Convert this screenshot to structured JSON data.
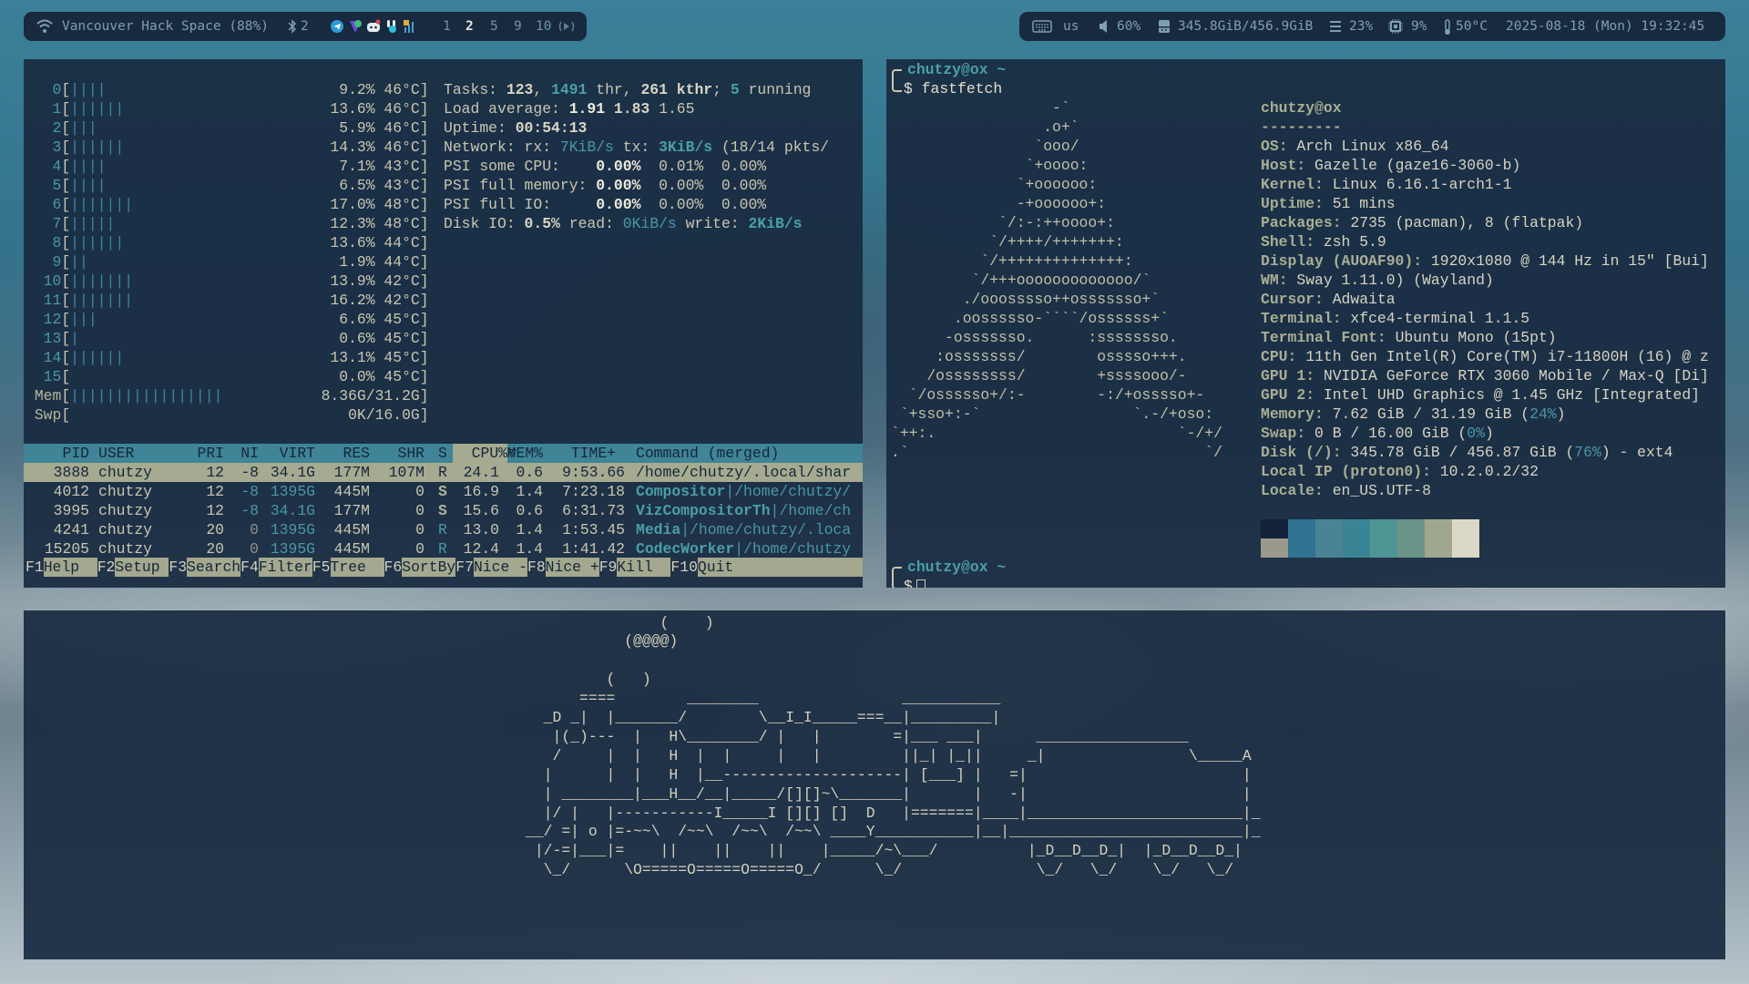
{
  "topbar_left": {
    "wifi_icon": "wifi-icon",
    "network": "Vancouver Hack Space (88%)",
    "bluetooth_icon": "bluetooth-icon",
    "bluetooth_count": "2",
    "tray_icons": [
      "telegram-icon",
      "protonvpn-icon",
      "discord-icon",
      "slack-icon",
      "network-manager-icon"
    ],
    "workspaces": [
      {
        "label": "1",
        "active": false
      },
      {
        "label": "2",
        "active": true
      },
      {
        "label": "5",
        "active": false
      },
      {
        "label": "9",
        "active": false
      },
      {
        "label": "10",
        "active": false
      }
    ],
    "audio_icon": "audio-output-icon"
  },
  "topbar_right": {
    "keyboard_layout": "us",
    "volume": "60%",
    "disk": "345.8GiB/456.9GiB",
    "memory": "23%",
    "cpu": "9%",
    "temperature": "50°C",
    "datetime": "2025-08-18 (Mon) 19:32:45"
  },
  "htop": {
    "cpus": [
      {
        "label": "0",
        "bars": 4,
        "pct": "9.2%",
        "temp": "46°C"
      },
      {
        "label": "1",
        "bars": 6,
        "pct": "13.6%",
        "temp": "46°C"
      },
      {
        "label": "2",
        "bars": 3,
        "pct": "5.9%",
        "temp": "46°C"
      },
      {
        "label": "3",
        "bars": 6,
        "pct": "14.3%",
        "temp": "46°C"
      },
      {
        "label": "4",
        "bars": 4,
        "pct": "7.1%",
        "temp": "43°C"
      },
      {
        "label": "5",
        "bars": 4,
        "pct": "6.5%",
        "temp": "43°C"
      },
      {
        "label": "6",
        "bars": 7,
        "pct": "17.0%",
        "temp": "48°C"
      },
      {
        "label": "7",
        "bars": 5,
        "pct": "12.3%",
        "temp": "48°C"
      },
      {
        "label": "8",
        "bars": 6,
        "pct": "13.6%",
        "temp": "44°C"
      },
      {
        "label": "9",
        "bars": 2,
        "pct": "1.9%",
        "temp": "44°C"
      },
      {
        "label": "10",
        "bars": 7,
        "pct": "13.9%",
        "temp": "42°C"
      },
      {
        "label": "11",
        "bars": 7,
        "pct": "16.2%",
        "temp": "42°C"
      },
      {
        "label": "12",
        "bars": 3,
        "pct": "6.6%",
        "temp": "45°C"
      },
      {
        "label": "13",
        "bars": 1,
        "pct": "0.6%",
        "temp": "45°C"
      },
      {
        "label": "14",
        "bars": 6,
        "pct": "13.1%",
        "temp": "45°C"
      },
      {
        "label": "15",
        "bars": 0,
        "pct": "0.0%",
        "temp": "45°C"
      }
    ],
    "mem": {
      "label": "Mem",
      "bars": 17,
      "value": "8.36G/31.2G"
    },
    "swp": {
      "label": "Swp",
      "bars": 0,
      "value": "0K/16.0G"
    },
    "info": [
      [
        {
          "t": "Tasks: ",
          "c": ""
        },
        {
          "t": "123",
          "c": "bold"
        },
        {
          "t": ", ",
          "c": ""
        },
        {
          "t": "1491",
          "c": "cyb"
        },
        {
          "t": " thr, ",
          "c": ""
        },
        {
          "t": "261 kthr",
          "c": "bold"
        },
        {
          "t": "; ",
          "c": ""
        },
        {
          "t": "5",
          "c": "cyb"
        },
        {
          "t": " running",
          "c": ""
        }
      ],
      [
        {
          "t": "Load average: ",
          "c": ""
        },
        {
          "t": "1.91",
          "c": "wb"
        },
        {
          "t": " ",
          "c": ""
        },
        {
          "t": "1.83",
          "c": "bold"
        },
        {
          "t": " 1.65",
          "c": ""
        }
      ],
      [
        {
          "t": "Uptime: ",
          "c": ""
        },
        {
          "t": "00:54:13",
          "c": "bold"
        }
      ],
      [
        {
          "t": "Network: rx: ",
          "c": ""
        },
        {
          "t": "7KiB/s",
          "c": "cy"
        },
        {
          "t": " tx: ",
          "c": ""
        },
        {
          "t": "3KiB/s",
          "c": "cyb"
        },
        {
          "t": " (18/14 pkts/",
          "c": ""
        }
      ],
      [
        {
          "t": "PSI some CPU:    ",
          "c": ""
        },
        {
          "t": "0.00%",
          "c": "wb"
        },
        {
          "t": "  0.01%  0.00%",
          "c": ""
        }
      ],
      [
        {
          "t": "PSI full memory: ",
          "c": ""
        },
        {
          "t": "0.00%",
          "c": "wb"
        },
        {
          "t": "  0.00%  0.00%",
          "c": ""
        }
      ],
      [
        {
          "t": "PSI full IO:     ",
          "c": ""
        },
        {
          "t": "0.00%",
          "c": "wb"
        },
        {
          "t": "  0.00%  0.00%",
          "c": ""
        }
      ],
      [
        {
          "t": "Disk IO: ",
          "c": ""
        },
        {
          "t": "0.5%",
          "c": "bold"
        },
        {
          "t": " read: ",
          "c": ""
        },
        {
          "t": "0KiB/s",
          "c": "cy"
        },
        {
          "t": " write: ",
          "c": ""
        },
        {
          "t": "2KiB/s",
          "c": "cyb"
        }
      ]
    ],
    "columns": {
      "pid": "PID",
      "user": "USER",
      "pri": "PRI",
      "ni": "NI",
      "virt": "VIRT",
      "res": "RES",
      "shr": "SHR",
      "s": "S",
      "cpu": "CPU%",
      "sort": "▽",
      "mem": "MEM%",
      "time": "TIME+",
      "cmd": "Command (merged)"
    },
    "processes": [
      {
        "pid": "3888",
        "user": "chutzy",
        "pri": "12",
        "ni": "-8",
        "virt": "34.1G",
        "res": "177M",
        "shr": "107M",
        "s": "R",
        "cpu": "24.1",
        "mem": "0.6",
        "time": "9:53.66",
        "name": "",
        "sep": "",
        "path": "/home/chutzy/.local/shar",
        "selected": true
      },
      {
        "pid": "4012",
        "user": "chutzy",
        "pri": "12",
        "ni": "-8",
        "virt": "1395G",
        "res": "445M",
        "shr": "0",
        "s": "S",
        "cpu": "16.9",
        "mem": "1.4",
        "time": "7:23.18",
        "name": "Compositor",
        "sep": "|",
        "path": "/home/chutzy/",
        "selected": false
      },
      {
        "pid": "3995",
        "user": "chutzy",
        "pri": "12",
        "ni": "-8",
        "virt": "34.1G",
        "res": "177M",
        "shr": "0",
        "s": "S",
        "cpu": "15.6",
        "mem": "0.6",
        "time": "6:31.73",
        "name": "VizCompositorTh",
        "sep": "|",
        "path": "/home/ch",
        "selected": false
      },
      {
        "pid": "4241",
        "user": "chutzy",
        "pri": "20",
        "ni": "0",
        "virt": "1395G",
        "res": "445M",
        "shr": "0",
        "s": "R",
        "cpu": "13.0",
        "mem": "1.4",
        "time": "1:53.45",
        "name": "Media",
        "sep": "|",
        "path": "/home/chutzy/.loca",
        "selected": false
      },
      {
        "pid": "15205",
        "user": "chutzy",
        "pri": "20",
        "ni": "0",
        "virt": "1395G",
        "res": "445M",
        "shr": "0",
        "s": "R",
        "cpu": "12.4",
        "mem": "1.4",
        "time": "1:41.42",
        "name": "CodecWorker",
        "sep": "|",
        "path": "/home/chutzy",
        "selected": false
      }
    ],
    "footer": [
      {
        "key": "F1",
        "label": "Help"
      },
      {
        "key": "F2",
        "label": "Setup"
      },
      {
        "key": "F3",
        "label": "Search"
      },
      {
        "key": "F4",
        "label": "Filter"
      },
      {
        "key": "F5",
        "label": "Tree"
      },
      {
        "key": "F6",
        "label": "SortBy"
      },
      {
        "key": "F7",
        "label": "Nice -"
      },
      {
        "key": "F8",
        "label": "Nice +"
      },
      {
        "key": "F9",
        "label": "Kill"
      },
      {
        "key": "F10",
        "label": "Quit"
      }
    ]
  },
  "fastfetch": {
    "prompt": "chutzy@ox ~",
    "command": "$ fastfetch",
    "logo": [
      "                  -`",
      "                 .o+`",
      "                `ooo/",
      "               `+oooo:",
      "              `+oooooo:",
      "              -+oooooo+:",
      "            `/:-:++oooo+:",
      "           `/++++/+++++++:",
      "          `/++++++++++++++:",
      "         `/+++ooooooooooooo/`",
      "        ./ooosssso++osssssso+`",
      "       .oossssso-````/ossssss+`",
      "      -osssssso.      :ssssssso.",
      "     :osssssss/        osssso+++.",
      "    /ossssssss/        +ssssooo/-",
      "  `/ossssso+/:-        -:/+osssso+-",
      " `+sso+:-`                 `.-/+oso:",
      "`++:.                           `-/+/",
      ".`                                 `/"
    ],
    "title": "chutzy@ox",
    "separator": "---------",
    "info": [
      {
        "key": "OS",
        "value": "Arch Linux x86_64"
      },
      {
        "key": "Host",
        "value": "Gazelle (gaze16-3060-b)"
      },
      {
        "key": "Kernel",
        "value": "Linux 6.16.1-arch1-1"
      },
      {
        "key": "Uptime",
        "value": "51 mins"
      },
      {
        "key": "Packages",
        "value": "2735 (pacman), 8 (flatpak)"
      },
      {
        "key": "Shell",
        "value": "zsh 5.9"
      },
      {
        "key": "Display (AUOAF90)",
        "value": "1920x1080 @ 144 Hz in 15\" [Bui]"
      },
      {
        "key": "WM",
        "value": "Sway 1.11.0) (Wayland)"
      },
      {
        "key": "Cursor",
        "value": "Adwaita"
      },
      {
        "key": "Terminal",
        "value": "xfce4-terminal 1.1.5"
      },
      {
        "key": "Terminal Font",
        "value": "Ubuntu Mono (15pt)"
      },
      {
        "key": "CPU",
        "value": "11th Gen Intel(R) Core(TM) i7-11800H (16) @ z"
      },
      {
        "key": "GPU 1",
        "value": "NVIDIA GeForce RTX 3060 Mobile / Max-Q [Di]"
      },
      {
        "key": "GPU 2",
        "value": "Intel UHD Graphics @ 1.45 GHz [Integrated]"
      },
      {
        "key": "Memory",
        "value": "7.62 GiB / 31.19 GiB (",
        "pct": "24%",
        "tail": ")"
      },
      {
        "key": "Swap",
        "value": "0 B / 16.00 GiB (",
        "pct": "0%",
        "tail": ")"
      },
      {
        "key": "Disk (/)",
        "value": "345.78 GiB / 456.87 GiB (",
        "pct": "76%",
        "tail": ") - ext4"
      },
      {
        "key": "Local IP (proton0)",
        "value": "10.2.0.2/32"
      },
      {
        "key": "Locale",
        "value": "en_US.UTF-8"
      }
    ],
    "palette_top": [
      "#15223a",
      "#2f7391",
      "#4a8394",
      "#3a8595",
      "#4f9595",
      "#6b9489",
      "#9fa88f",
      "#dbd8c8"
    ],
    "palette_bottom": [
      "#9b998e",
      "#2f7391",
      "#4a8394",
      "#3a8595",
      "#4f9595",
      "#6b9489",
      "#9fa88f",
      "#dbd8c8"
    ],
    "prompt2": "chutzy@ox ~",
    "prompt2_symbol": "$"
  },
  "train": {
    "lines": [
      "               (    )",
      "           (@@@@)",
      "",
      "         (   )",
      "      ====        ________                ___________",
      "  _D _|  |_______/        \\__I_I_____===__|_________|",
      "   |(_)---  |   H\\________/ |   |        =|___ ___|      _________________",
      "   /     |  |   H  |  |     |   |         ||_| |_||     _|                \\_____A",
      "  |      |  |   H  |__--------------------| [___] |   =|                        |",
      "  | ________|___H__/__|_____/[][]~\\_______|       |   -|                        |",
      "  |/ |   |-----------I_____I [][] []  D   |=======|____|________________________|_",
      "__/ =| o |=-~~\\  /~~\\  /~~\\  /~~\\ ____Y___________|__|__________________________|_",
      " |/-=|___|=    ||    ||    ||    |_____/~\\___/          |_D__D__D_|  |_D__D__D_|",
      "  \\_/      \\O=====O=====O=====O_/      \\_/               \\_/   \\_/    \\_/   \\_/"
    ]
  }
}
